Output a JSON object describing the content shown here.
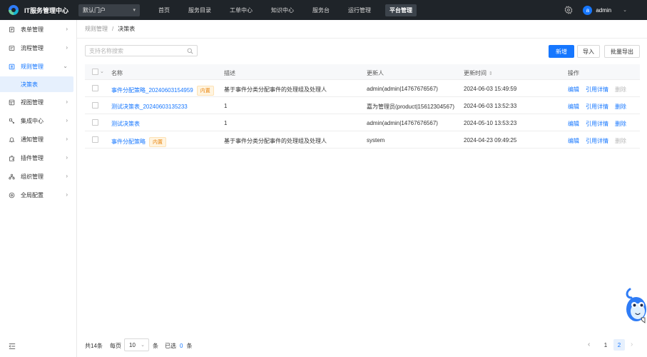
{
  "header": {
    "app_title": "IT服务管理中心",
    "portal_select": "默认门户",
    "nav": [
      "首页",
      "服务目录",
      "工单中心",
      "知识中心",
      "服务台",
      "运行管理",
      "平台管理"
    ],
    "active_nav_index": 6,
    "user": {
      "avatar_letter": "a",
      "name": "admin"
    }
  },
  "sidebar": {
    "items": [
      {
        "label": "表单管理",
        "icon": "form-icon"
      },
      {
        "label": "流程管理",
        "icon": "flow-icon"
      },
      {
        "label": "规则管理",
        "icon": "rule-icon",
        "open": true
      },
      {
        "label": "视图管理",
        "icon": "view-icon"
      },
      {
        "label": "集成中心",
        "icon": "integration-icon"
      },
      {
        "label": "通知管理",
        "icon": "bell-icon"
      },
      {
        "label": "插件管理",
        "icon": "plugin-icon"
      },
      {
        "label": "组织管理",
        "icon": "org-icon"
      },
      {
        "label": "全局配置",
        "icon": "settings-icon"
      }
    ],
    "sub_item": "决策表"
  },
  "breadcrumb": {
    "parent": "规则管理",
    "separator": "/",
    "current": "决策表"
  },
  "toolbar": {
    "search_placeholder": "支持名称搜索",
    "add_label": "新增",
    "import_label": "导入",
    "export_label": "批量导出"
  },
  "table": {
    "columns": {
      "name": "名称",
      "desc": "描述",
      "updater": "更新人",
      "time": "更新时间",
      "ops": "操作"
    },
    "rows": [
      {
        "name": "事件分配策略_20240603154959",
        "tag": "内置",
        "desc": "基于事件分类分配事件的处理组及处理人",
        "updater": "admin(admin|14767676567)",
        "time": "2024-06-03 15:49:59",
        "delete_enabled": false
      },
      {
        "name": "测试决策表_20240603135233",
        "tag": "",
        "desc": "1",
        "updater": "嘉为管理员(product|15612304567)",
        "time": "2024-06-03 13:52:33",
        "delete_enabled": true
      },
      {
        "name": "测试决策表",
        "tag": "",
        "desc": "1",
        "updater": "admin(admin|14767676567)",
        "time": "2024-05-10 13:53:23",
        "delete_enabled": true
      },
      {
        "name": "事件分配策略",
        "tag": "内置",
        "desc": "基于事件分类分配事件的处理组及处理人",
        "updater": "system",
        "time": "2024-04-23 09:49:25",
        "delete_enabled": false
      }
    ],
    "ops": {
      "edit": "编辑",
      "ref": "引用详情",
      "delete": "删除"
    }
  },
  "pagination": {
    "total": "共14条",
    "per_page_label": "每页",
    "page_size": "10",
    "unit": "条",
    "selected_label": "已选",
    "selected_count": "0",
    "selected_unit": "条",
    "pages": [
      "1",
      "2"
    ],
    "current_page": "2"
  },
  "colors": {
    "primary": "#1677ff",
    "topbar": "#1f2429",
    "tag_bg": "#fff4e0",
    "tag_text": "#e8830c"
  }
}
